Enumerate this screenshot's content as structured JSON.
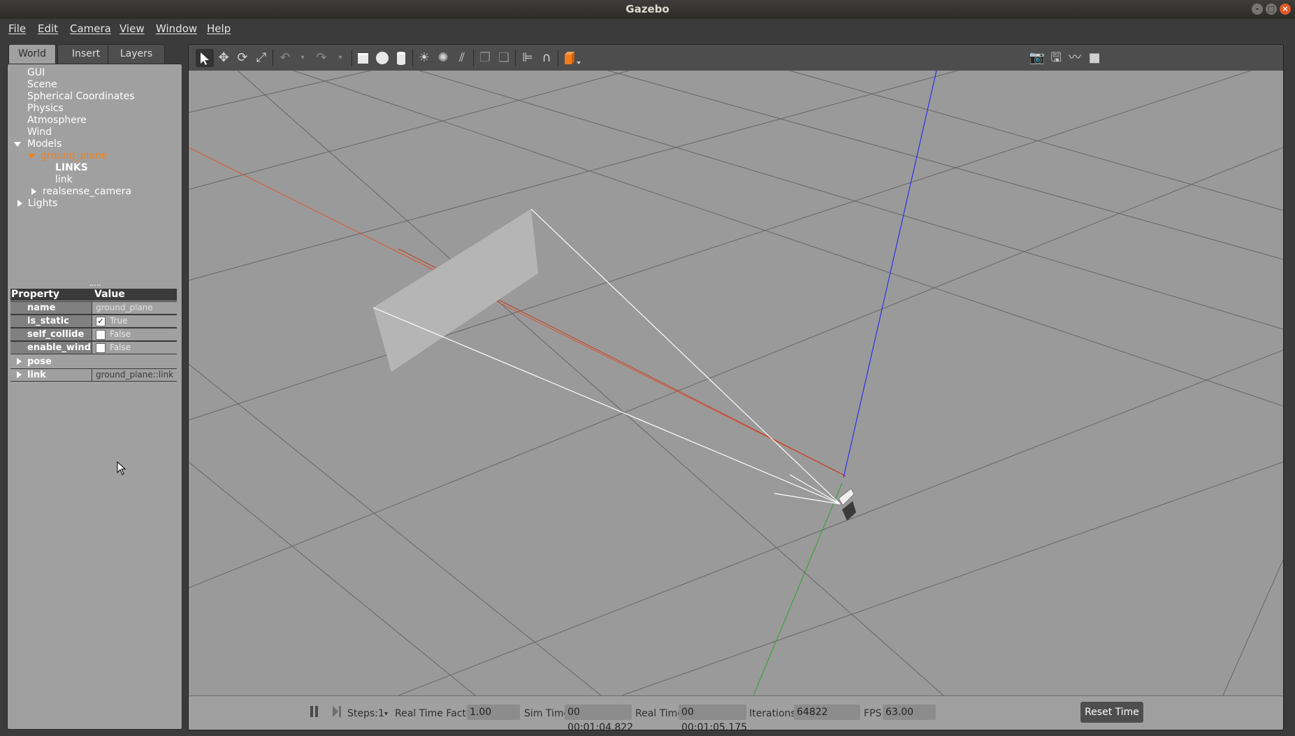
{
  "window": {
    "title": "Gazebo"
  },
  "menu": [
    "File",
    "Edit",
    "Camera",
    "View",
    "Window",
    "Help"
  ],
  "left_panel": {
    "tabs": [
      "World",
      "Insert",
      "Layers"
    ],
    "active_tab": "World",
    "tree": {
      "gui": "GUI",
      "scene": "Scene",
      "spherical": "Spherical Coordinates",
      "physics": "Physics",
      "atmosphere": "Atmosphere",
      "wind": "Wind",
      "models": "Models",
      "ground_plane": "ground_plane",
      "links": "LINKS",
      "link": "link",
      "realsense_camera": "realsense_camera",
      "lights": "Lights"
    },
    "properties": {
      "header_property": "Property",
      "header_value": "Value",
      "rows": [
        {
          "name": "name",
          "value": "ground_plane"
        },
        {
          "name": "is_static",
          "value": "True",
          "checked": true
        },
        {
          "name": "self_collide",
          "value": "False",
          "checked": false
        },
        {
          "name": "enable_wind",
          "value": "False",
          "checked": false
        },
        {
          "name": "pose",
          "value": ""
        },
        {
          "name": "link",
          "value": "ground_plane::link"
        }
      ]
    }
  },
  "toolbar": {
    "icons": [
      "select-arrow-icon",
      "translate-icon",
      "rotate-icon",
      "scale-icon",
      "undo-icon",
      "undo-dropdown-icon",
      "redo-icon",
      "redo-dropdown-icon",
      "box-icon",
      "sphere-icon",
      "cylinder-icon",
      "point-light-icon",
      "spot-light-icon",
      "directional-light-icon",
      "copy-icon",
      "paste-icon",
      "align-icon",
      "snap-icon",
      "view-angle-icon",
      "screenshot-icon",
      "log-icon",
      "plot-icon",
      "record-icon"
    ]
  },
  "status": {
    "steps_label": "Steps:",
    "steps_value": "1",
    "rtf_label": "Real Time Factor:",
    "rtf_value": "1.00",
    "sim_time_label": "Sim Time:",
    "sim_time_value": "00 00:01:04.822",
    "real_time_label": "Real Time:",
    "real_time_value": "00 00:01:05.175",
    "iterations_label": "Iterations:",
    "iterations_value": "64822",
    "fps_label": "FPS:",
    "fps_value": "63.00",
    "reset_label": "Reset Time"
  },
  "colors": {
    "selected_model": "#f58113",
    "x_axis": "#e0502a",
    "y_axis": "#2fa02f",
    "z_axis": "#1a1aff",
    "view_accent": "#f07c1c"
  }
}
